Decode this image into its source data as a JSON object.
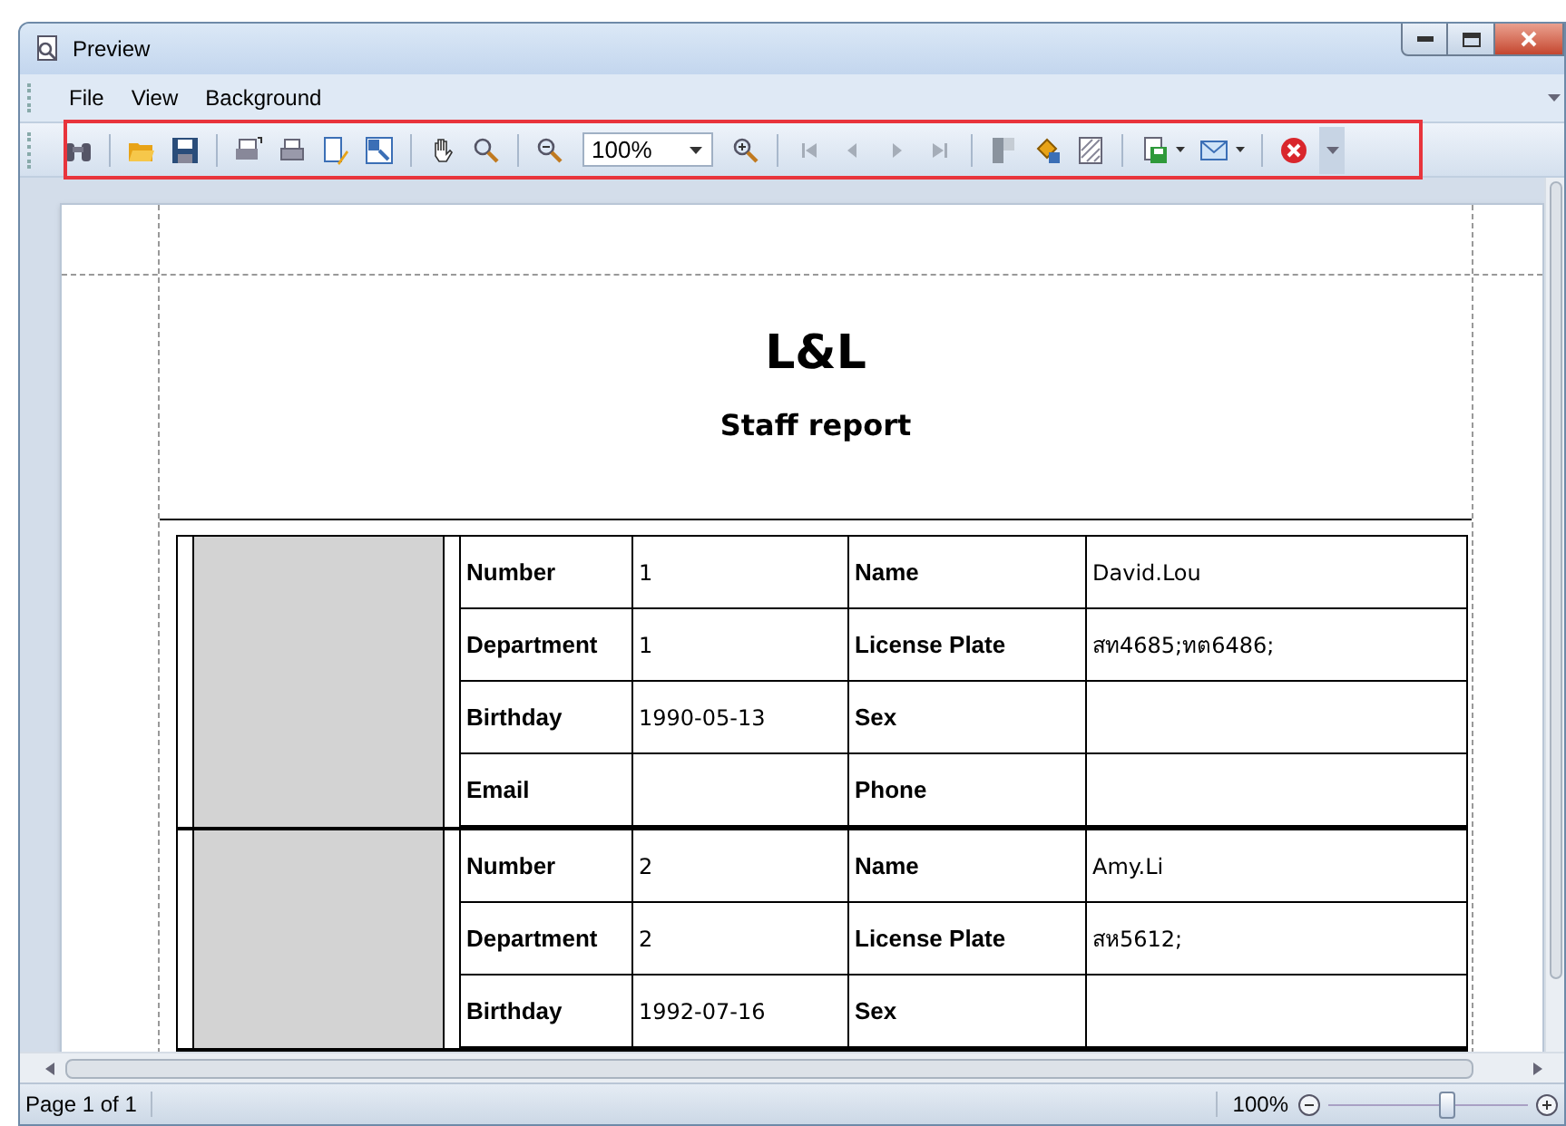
{
  "window": {
    "title": "Preview"
  },
  "menu": [
    "File",
    "View",
    "Background"
  ],
  "toolbar": {
    "zoom": "100%",
    "navigation": [
      {
        "disabled": true
      },
      {
        "disabled": true
      },
      {
        "disabled": true
      },
      {
        "disabled": true
      }
    ]
  },
  "report": {
    "title": "L&L",
    "subtitle": "Staff report",
    "records": [
      {
        "rows": [
          [
            {
              "label": "Number",
              "value": "1"
            },
            {
              "label": "Name",
              "value": "David.Lou"
            }
          ],
          [
            {
              "label": "Department",
              "value": "1"
            },
            {
              "label": "License Plate",
              "value": "สท4685;ทต6486;"
            }
          ],
          [
            {
              "label": "Birthday",
              "value": "1990-05-13"
            },
            {
              "label": "Sex"
            }
          ],
          [
            {
              "label": "Email"
            },
            {
              "label": "Phone"
            }
          ]
        ]
      },
      {
        "rows": [
          [
            {
              "label": "Number",
              "value": "2"
            },
            {
              "label": "Name",
              "value": "Amy.Li"
            }
          ],
          [
            {
              "label": "Department",
              "value": "2"
            },
            {
              "label": "License Plate",
              "value": "สห5612;"
            }
          ],
          [
            {
              "label": "Birthday",
              "value": "1992-07-16"
            },
            {
              "label": "Sex"
            }
          ]
        ]
      }
    ]
  },
  "status_bar": {
    "page": "Page 1 of 1",
    "zoom": "100%",
    "zoom_slider": {
      "level": 0.6
    }
  }
}
